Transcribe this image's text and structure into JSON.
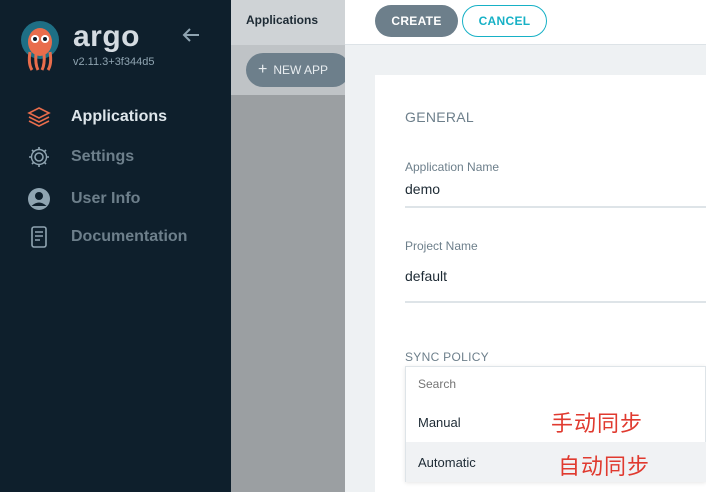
{
  "sidebar": {
    "brand": "argo",
    "version": "v2.11.3+3f344d5",
    "items": [
      {
        "label": "Applications",
        "icon": "stack-icon",
        "active": true
      },
      {
        "label": "Settings",
        "icon": "gear-icon",
        "active": false
      },
      {
        "label": "User Info",
        "icon": "user-icon",
        "active": false
      },
      {
        "label": "Documentation",
        "icon": "book-icon",
        "active": false
      }
    ]
  },
  "header": {
    "breadcrumb": "Applications",
    "new_app_label": "NEW APP"
  },
  "panel": {
    "create_label": "CREATE",
    "cancel_label": "CANCEL",
    "general_title": "GENERAL",
    "app_name_label": "Application Name",
    "app_name_value": "demo",
    "project_label": "Project Name",
    "project_value": "default",
    "sync_policy_title": "SYNC POLICY",
    "dropdown": {
      "search_placeholder": "Search",
      "options": [
        "Manual",
        "Automatic"
      ],
      "hovered": "Automatic"
    }
  },
  "annotations": {
    "manual_note": "手动同步",
    "automatic_note": "自动同步"
  },
  "colors": {
    "sidebar_bg": "#0e1f2c",
    "accent": "#17b1c6",
    "button_grey": "#6d7f8b",
    "annotation_red": "#e03a2f",
    "active_icon": "#e96d4c"
  }
}
